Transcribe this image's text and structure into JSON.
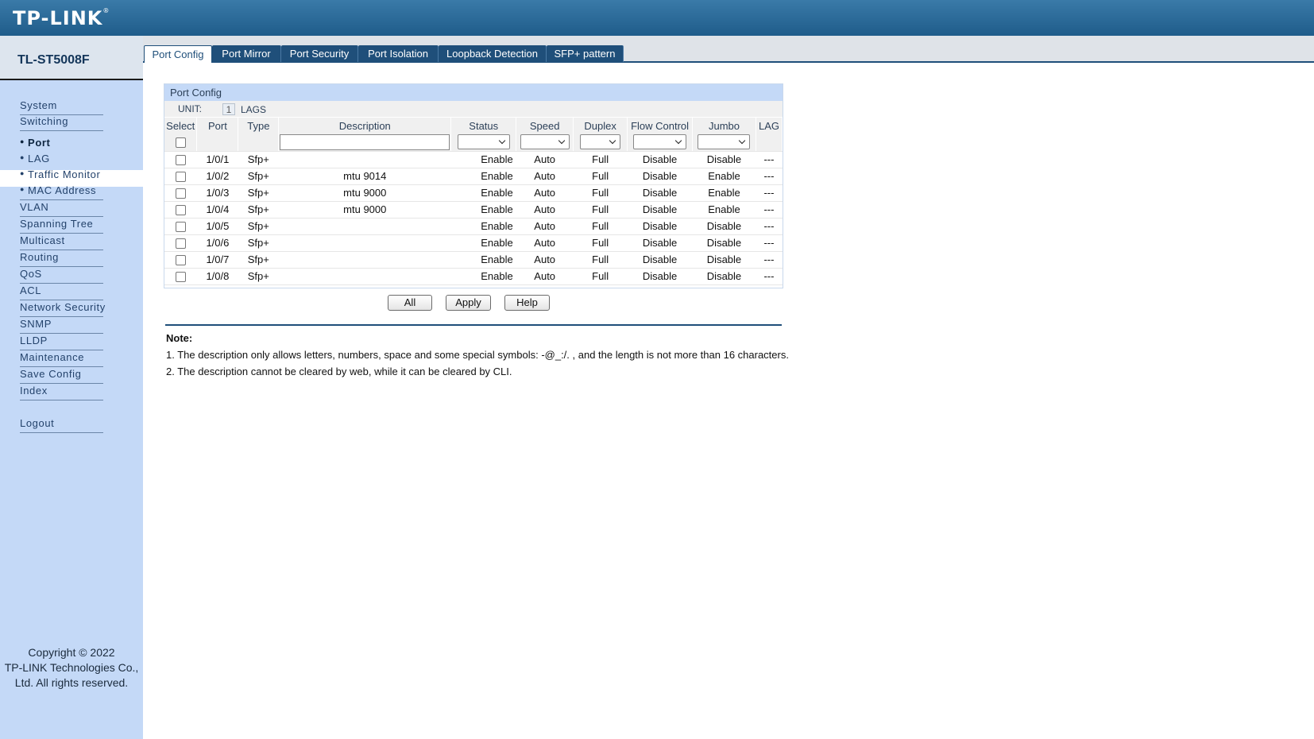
{
  "header": {
    "logo": "TP-LINK",
    "logo_mark": "®"
  },
  "sidebar": {
    "model": "TL-ST5008F",
    "items": [
      {
        "label": "System"
      },
      {
        "label": "Switching"
      },
      {
        "label": "Port"
      },
      {
        "label": "LAG"
      },
      {
        "label": "Traffic Monitor"
      },
      {
        "label": "MAC Address"
      },
      {
        "label": "VLAN"
      },
      {
        "label": "Spanning Tree"
      },
      {
        "label": "Multicast"
      },
      {
        "label": "Routing"
      },
      {
        "label": "QoS"
      },
      {
        "label": "ACL"
      },
      {
        "label": "Network Security"
      },
      {
        "label": "SNMP"
      },
      {
        "label": "LLDP"
      },
      {
        "label": "Maintenance"
      },
      {
        "label": "Save Config"
      },
      {
        "label": "Index"
      },
      {
        "label": "Logout"
      }
    ],
    "copyright": [
      "Copyright © 2022",
      "TP-LINK Technologies Co.,",
      "Ltd. All rights reserved."
    ]
  },
  "tabs": [
    {
      "label": "Port Config",
      "active": true
    },
    {
      "label": "Port Mirror"
    },
    {
      "label": "Port Security"
    },
    {
      "label": "Port Isolation"
    },
    {
      "label": "Loopback Detection"
    },
    {
      "label": "SFP+ pattern"
    }
  ],
  "panel": {
    "title": "Port Config",
    "unit_label": "UNIT:",
    "unit_value": "1",
    "lags_label": "LAGS",
    "columns": [
      "Select",
      "Port",
      "Type",
      "Description",
      "Status",
      "Speed",
      "Duplex",
      "Flow Control",
      "Jumbo",
      "LAG"
    ],
    "rows": [
      {
        "port": "1/0/1",
        "type": "Sfp+",
        "description": "",
        "status": "Enable",
        "speed": "Auto",
        "duplex": "Full",
        "flow": "Disable",
        "jumbo": "Disable",
        "lag": "---"
      },
      {
        "port": "1/0/2",
        "type": "Sfp+",
        "description": "mtu 9014",
        "status": "Enable",
        "speed": "Auto",
        "duplex": "Full",
        "flow": "Disable",
        "jumbo": "Enable",
        "lag": "---"
      },
      {
        "port": "1/0/3",
        "type": "Sfp+",
        "description": "mtu 9000",
        "status": "Enable",
        "speed": "Auto",
        "duplex": "Full",
        "flow": "Disable",
        "jumbo": "Enable",
        "lag": "---"
      },
      {
        "port": "1/0/4",
        "type": "Sfp+",
        "description": "mtu 9000",
        "status": "Enable",
        "speed": "Auto",
        "duplex": "Full",
        "flow": "Disable",
        "jumbo": "Enable",
        "lag": "---"
      },
      {
        "port": "1/0/5",
        "type": "Sfp+",
        "description": "",
        "status": "Enable",
        "speed": "Auto",
        "duplex": "Full",
        "flow": "Disable",
        "jumbo": "Disable",
        "lag": "---"
      },
      {
        "port": "1/0/6",
        "type": "Sfp+",
        "description": "",
        "status": "Enable",
        "speed": "Auto",
        "duplex": "Full",
        "flow": "Disable",
        "jumbo": "Disable",
        "lag": "---"
      },
      {
        "port": "1/0/7",
        "type": "Sfp+",
        "description": "",
        "status": "Enable",
        "speed": "Auto",
        "duplex": "Full",
        "flow": "Disable",
        "jumbo": "Disable",
        "lag": "---"
      },
      {
        "port": "1/0/8",
        "type": "Sfp+",
        "description": "",
        "status": "Enable",
        "speed": "Auto",
        "duplex": "Full",
        "flow": "Disable",
        "jumbo": "Disable",
        "lag": "---"
      }
    ]
  },
  "buttons": {
    "all": "All",
    "apply": "Apply",
    "help": "Help"
  },
  "note": {
    "title": "Note:",
    "lines": [
      "1. The description only allows letters, numbers, space and some special symbols: -@_:/. , and the length is not more than 16 characters.",
      "2. The description cannot be cleared by web, while it can be cleared by CLI."
    ]
  },
  "colors": {
    "header": "#1f5c8a",
    "sidebar": "#c4d9f7",
    "tab": "#1f4f7a",
    "panel_title": "#c4d9f7"
  }
}
